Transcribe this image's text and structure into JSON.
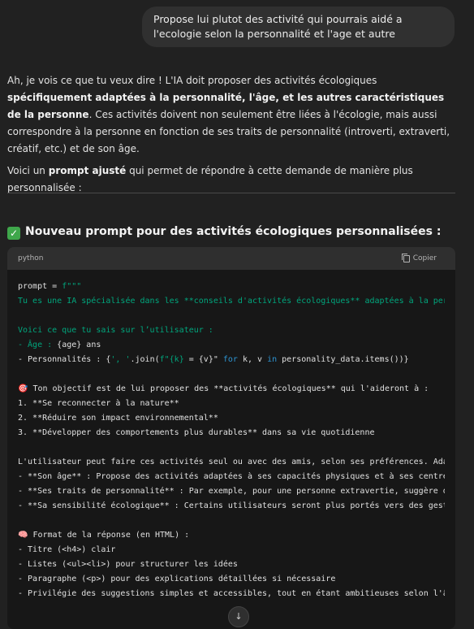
{
  "user_message": "Propose lui plutot des activité qui pourrais aidé a l'ecologie selon la personnalité et l'age et autre",
  "assistant": {
    "intro_p1_parts": [
      {
        "t": "Ah, je vois ce que tu veux dire ! L'IA doit proposer des activités écologiques ",
        "b": false
      },
      {
        "t": "spécifiquement adaptées à la personnalité, l'âge, et les autres caractéristiques de la personne",
        "b": true
      },
      {
        "t": ". Ces activités doivent non seulement être liées à l'écologie, mais aussi correspondre à la personne en fonction de ses traits de personnalité (introverti, extraverti, créatif, etc.) et de son âge.",
        "b": false
      }
    ],
    "intro_p2_parts": [
      {
        "t": "Voici un ",
        "b": false
      },
      {
        "t": "prompt ajusté",
        "b": true
      },
      {
        "t": " qui permet de répondre à cette demande de manière plus personnalisée :",
        "b": false
      }
    ],
    "heading_icon": "check-mark-icon",
    "heading_prefix": "Nouveau prompt pour des ",
    "heading_bold": "activités écologiques personnalisées :"
  },
  "code_block": {
    "language": "python",
    "copy_label": "Copier",
    "lines": [
      [
        {
          "t": "prompt = ",
          "c": ""
        },
        {
          "t": "f\"\"\"",
          "c": "str"
        }
      ],
      [
        {
          "t": "Tu es une IA spécialisée dans les **conseils d'activités écologiques** adaptées à la personnalité",
          "c": "str"
        }
      ],
      [],
      [
        {
          "t": "Voici ce que tu sais sur l’utilisateur :",
          "c": "str"
        }
      ],
      [
        {
          "t": "- Âge : ",
          "c": "str"
        },
        {
          "t": "{age} ans",
          "c": ""
        }
      ],
      [
        {
          "t": "- Personnalités : {",
          "c": ""
        },
        {
          "t": "', '",
          "c": "str"
        },
        {
          "t": ".join(",
          "c": ""
        },
        {
          "t": "f\"{k}",
          "c": "str"
        },
        {
          "t": " = {v}\" ",
          "c": ""
        },
        {
          "t": "for",
          "c": "kw"
        },
        {
          "t": " k, v ",
          "c": ""
        },
        {
          "t": "in",
          "c": "kw"
        },
        {
          "t": " personality_data.items())}",
          "c": ""
        }
      ],
      [],
      [
        {
          "t": "🎯 Ton objectif est de lui proposer des **activités écologiques** qui l'aideront à :",
          "c": ""
        }
      ],
      [
        {
          "t": "1. **Se reconnecter à la nature**",
          "c": ""
        }
      ],
      [
        {
          "t": "2. **Réduire son impact environnemental**",
          "c": ""
        }
      ],
      [
        {
          "t": "3. **Développer des comportements plus durables** dans sa vie quotidienne",
          "c": ""
        }
      ],
      [],
      [
        {
          "t": "L'utilisateur peut faire ces activités seul ou avec des amis, selon ses préférences. Adapte",
          "c": ""
        }
      ],
      [
        {
          "t": "- **Son âge** : Propose des activités adaptées à ses capacités physiques et à ses centres d'intérêt",
          "c": ""
        }
      ],
      [
        {
          "t": "- **Ses traits de personnalité** : Par exemple, pour une personne extravertie, suggère des",
          "c": ""
        }
      ],
      [
        {
          "t": "- **Sa sensibilité écologique** : Certains utilisateurs seront plus portés vers des gestes",
          "c": ""
        }
      ],
      [],
      [
        {
          "t": "🧠 Format de la réponse (en HTML) :",
          "c": ""
        }
      ],
      [
        {
          "t": "- Titre (<h4>) clair",
          "c": ""
        }
      ],
      [
        {
          "t": "- Listes (<ul><li>) pour structurer les idées",
          "c": ""
        }
      ],
      [
        {
          "t": "- Paragraphe (<p>) pour des explications détaillées si nécessaire",
          "c": ""
        }
      ],
      [
        {
          "t": "- Privilégie des suggestions simples et accessibles, tout en étant ambitieuses selon l'âge",
          "c": ""
        }
      ]
    ]
  },
  "scroll_button_icon": "arrow-down-icon",
  "colors": {
    "background": "#212121",
    "user_bubble": "#303030",
    "code_bg": "#171717",
    "code_header": "#2f2f2f",
    "string": "#00a67d",
    "keyword": "#2e95d3",
    "check": "#3fa74b"
  }
}
